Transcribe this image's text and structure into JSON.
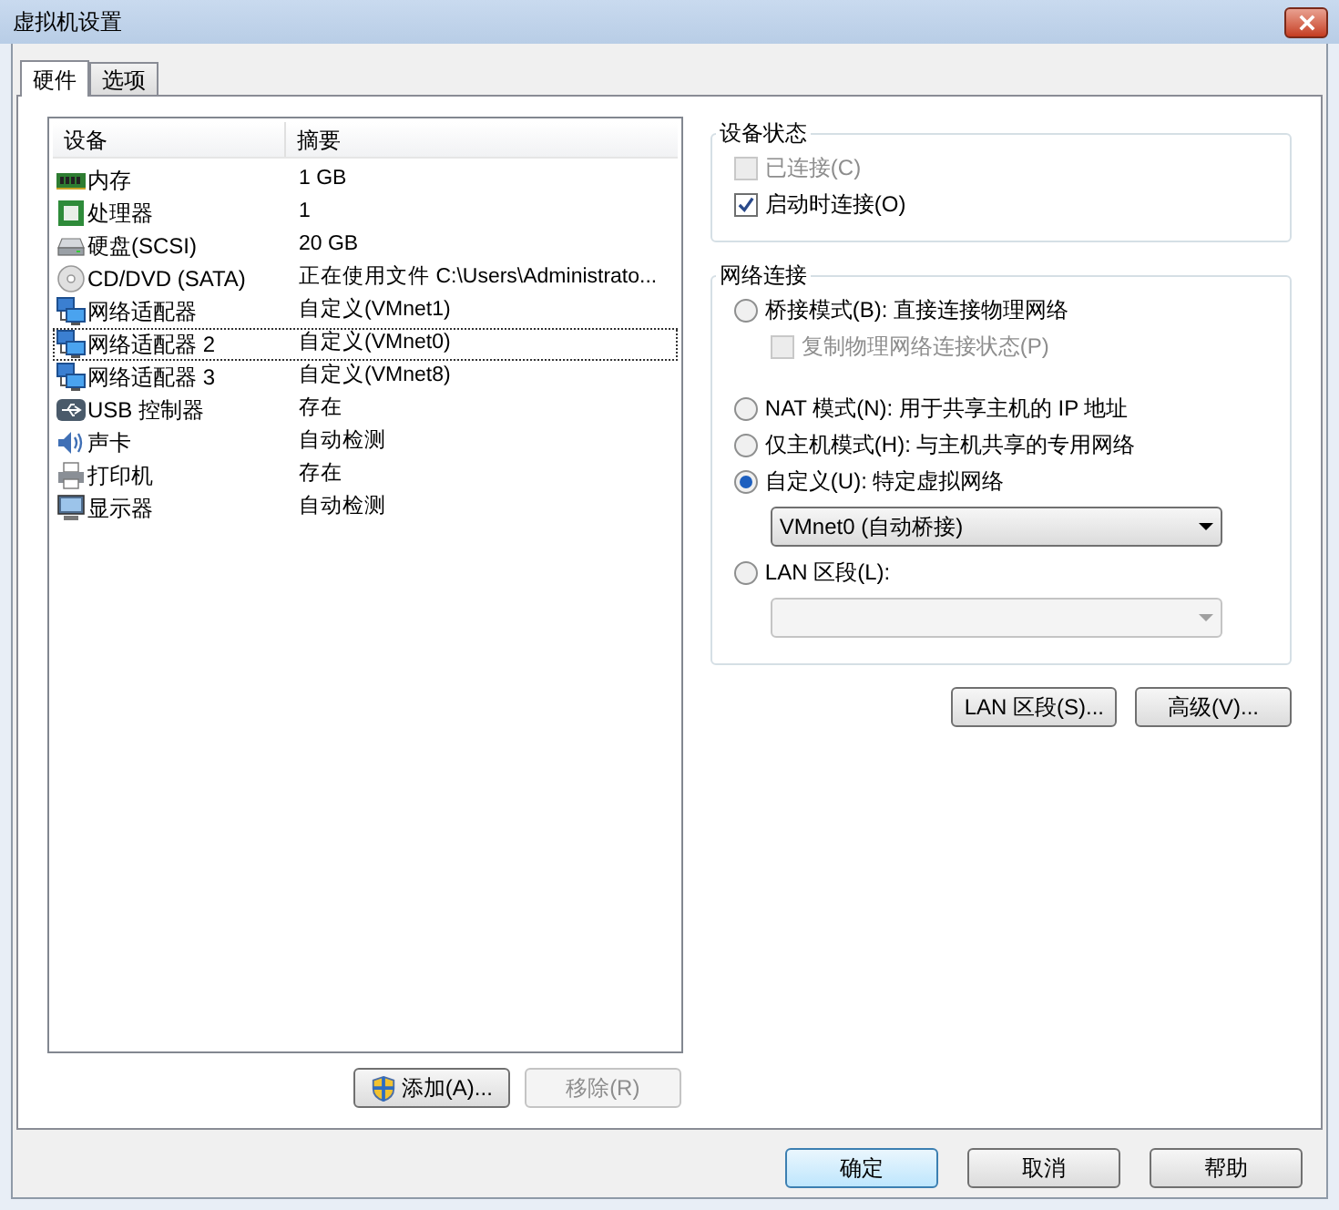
{
  "window": {
    "title": "虚拟机设置"
  },
  "tabs": [
    {
      "label": "硬件",
      "selected": true
    },
    {
      "label": "选项",
      "selected": false
    }
  ],
  "devices": {
    "columns": [
      "设备",
      "摘要"
    ],
    "rows": [
      {
        "kind": "memory",
        "name": "内存",
        "summary": "1 GB",
        "selected": false
      },
      {
        "kind": "cpu",
        "name": "处理器",
        "summary": "1",
        "selected": false
      },
      {
        "kind": "disk",
        "name": "硬盘(SCSI)",
        "summary": "20 GB",
        "selected": false
      },
      {
        "kind": "cd",
        "name": "CD/DVD (SATA)",
        "summary": "正在使用文件 C:\\Users\\Administrato...",
        "selected": false
      },
      {
        "kind": "network",
        "name": "网络适配器",
        "summary": "自定义(VMnet1)",
        "selected": false
      },
      {
        "kind": "network",
        "name": "网络适配器 2",
        "summary": "自定义(VMnet0)",
        "selected": true
      },
      {
        "kind": "network",
        "name": "网络适配器 3",
        "summary": "自定义(VMnet8)",
        "selected": false
      },
      {
        "kind": "usb",
        "name": "USB 控制器",
        "summary": "存在",
        "selected": false
      },
      {
        "kind": "sound",
        "name": "声卡",
        "summary": "自动检测",
        "selected": false
      },
      {
        "kind": "printer",
        "name": "打印机",
        "summary": "存在",
        "selected": false
      },
      {
        "kind": "monitor",
        "name": "显示器",
        "summary": "自动检测",
        "selected": false
      }
    ],
    "buttons": [
      {
        "label": "添加(A)...",
        "shield": true,
        "disabled": false
      },
      {
        "label": "移除(R)",
        "shield": false,
        "disabled": true
      }
    ]
  },
  "device_status": {
    "title": "设备状态",
    "items": [
      {
        "label": "已连接(C)",
        "checked": false,
        "disabled": true
      },
      {
        "label": "启动时连接(O)",
        "checked": true,
        "disabled": false
      }
    ]
  },
  "network_connection": {
    "title": "网络连接",
    "items": [
      {
        "kind": "radio",
        "label": "桥接模式(B): 直接连接物理网络",
        "selected": false
      },
      {
        "kind": "checkbox",
        "label": "复制物理网络连接状态(P)",
        "checked": false,
        "disabled": true
      },
      {
        "kind": "radio",
        "label": "NAT 模式(N): 用于共享主机的 IP 地址",
        "selected": false
      },
      {
        "kind": "radio",
        "label": "仅主机模式(H): 与主机共享的专用网络",
        "selected": false
      },
      {
        "kind": "radio",
        "label": "自定义(U): 特定虚拟网络",
        "selected": true
      },
      {
        "kind": "select",
        "value": "VMnet0 (自动桥接)",
        "disabled": false
      },
      {
        "kind": "radio",
        "label": "LAN 区段(L):",
        "selected": false
      },
      {
        "kind": "select",
        "disabled": true
      }
    ]
  },
  "panel_buttons": [
    "LAN 区段(S)...",
    "高级(V)..."
  ],
  "dialog_buttons": [
    {
      "label": "确定",
      "default": true
    },
    {
      "label": "取消",
      "default": false
    },
    {
      "label": "帮助",
      "default": false
    }
  ]
}
